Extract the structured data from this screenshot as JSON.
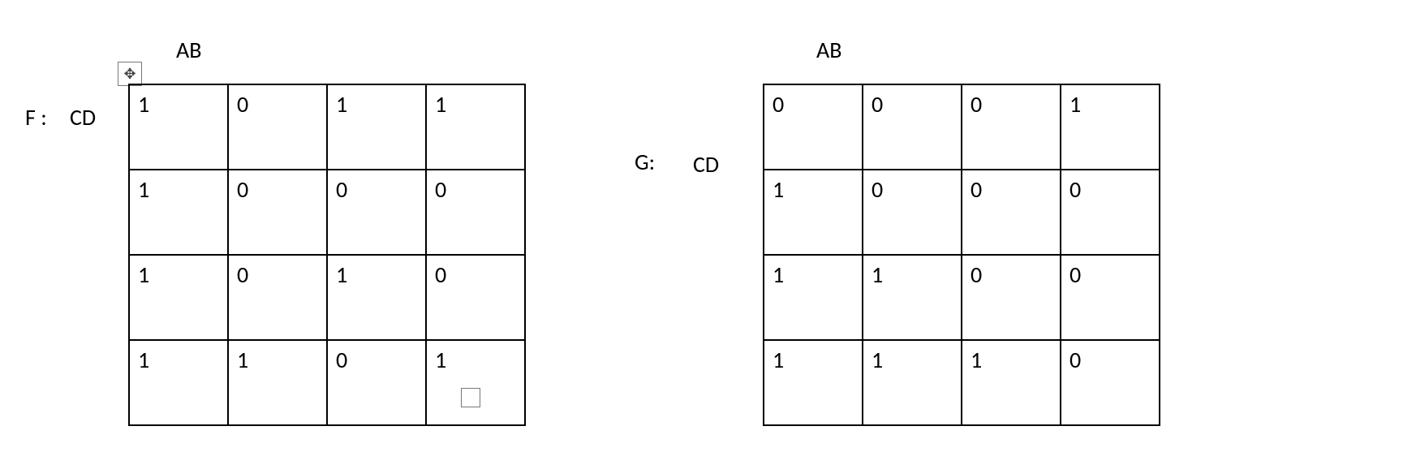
{
  "chart_data": [
    {
      "type": "table",
      "name": "F",
      "col_label": "AB",
      "row_label": "CD",
      "values": [
        [
          1,
          0,
          1,
          1
        ],
        [
          1,
          0,
          0,
          0
        ],
        [
          1,
          0,
          1,
          0
        ],
        [
          1,
          1,
          0,
          1
        ]
      ]
    },
    {
      "type": "table",
      "name": "G",
      "col_label": "AB",
      "row_label": "CD",
      "values": [
        [
          0,
          0,
          0,
          1
        ],
        [
          1,
          0,
          0,
          0
        ],
        [
          1,
          1,
          0,
          0
        ],
        [
          1,
          1,
          1,
          0
        ]
      ]
    }
  ],
  "tableF": {
    "name_label": "F :",
    "col_label": "AB",
    "row_label": "CD",
    "r0": {
      "c0": "1",
      "c1": "0",
      "c2": "1",
      "c3": "1"
    },
    "r1": {
      "c0": "1",
      "c1": "0",
      "c2": "0",
      "c3": "0"
    },
    "r2": {
      "c0": "1",
      "c1": "0",
      "c2": "1",
      "c3": "0"
    },
    "r3": {
      "c0": "1",
      "c1": "1",
      "c2": "0",
      "c3": "1"
    }
  },
  "tableG": {
    "name_label": "G:",
    "col_label": "AB",
    "row_label": "CD",
    "r0": {
      "c0": "0",
      "c1": "0",
      "c2": "0",
      "c3": "1"
    },
    "r1": {
      "c0": "1",
      "c1": "0",
      "c2": "0",
      "c3": "0"
    },
    "r2": {
      "c0": "1",
      "c1": "1",
      "c2": "0",
      "c3": "0"
    },
    "r3": {
      "c0": "1",
      "c1": "1",
      "c2": "1",
      "c3": "0"
    }
  }
}
